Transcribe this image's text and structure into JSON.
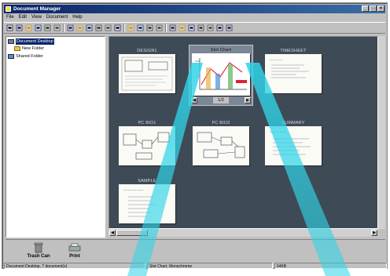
{
  "window": {
    "title": "Document Manager",
    "controls": [
      "_",
      "□",
      "×"
    ]
  },
  "menu": [
    "File",
    "Edit",
    "View",
    "Document",
    "Help"
  ],
  "toolbar_icons": [
    "new-icon",
    "open-icon",
    "folder-icon",
    "save-icon",
    "print-icon",
    "fax-icon",
    "sep",
    "cut-icon",
    "copy-icon",
    "paste-icon",
    "undo-icon",
    "find-icon",
    "delete-icon",
    "sep",
    "rotate-left-icon",
    "rotate-right-icon",
    "zoom-icon",
    "zoom-out-icon",
    "sep",
    "stack-icon",
    "unstack-icon",
    "mail-icon",
    "send-icon",
    "properties-icon",
    "help-icon",
    "trash-icon"
  ],
  "tree": {
    "root": "Document Desktop",
    "children": [
      "New Folder"
    ],
    "shared": "Shared Folder"
  },
  "documents": [
    {
      "title": "DESIGN1"
    },
    {
      "title": "Slot Chart",
      "selected": true,
      "page": "1/2"
    },
    {
      "title": "TIMESHEET"
    },
    {
      "title": "PC BIO1"
    },
    {
      "title": "PC BIO2"
    },
    {
      "title": "SUMMARY"
    },
    {
      "title": "SAMPLE"
    }
  ],
  "tray": [
    {
      "label": "Trash Can",
      "icon": "trash-can-icon"
    },
    {
      "label": "Print",
      "icon": "printer-icon"
    }
  ],
  "status": {
    "location": "Document Desktop, 7 document(s)",
    "selection": "Slot Chart, Monochrome",
    "size": "64KB"
  },
  "colors": {
    "viewer_bg": "#3e4a55",
    "beam": "#2fd4e8",
    "titlebar": "#0a246a"
  }
}
